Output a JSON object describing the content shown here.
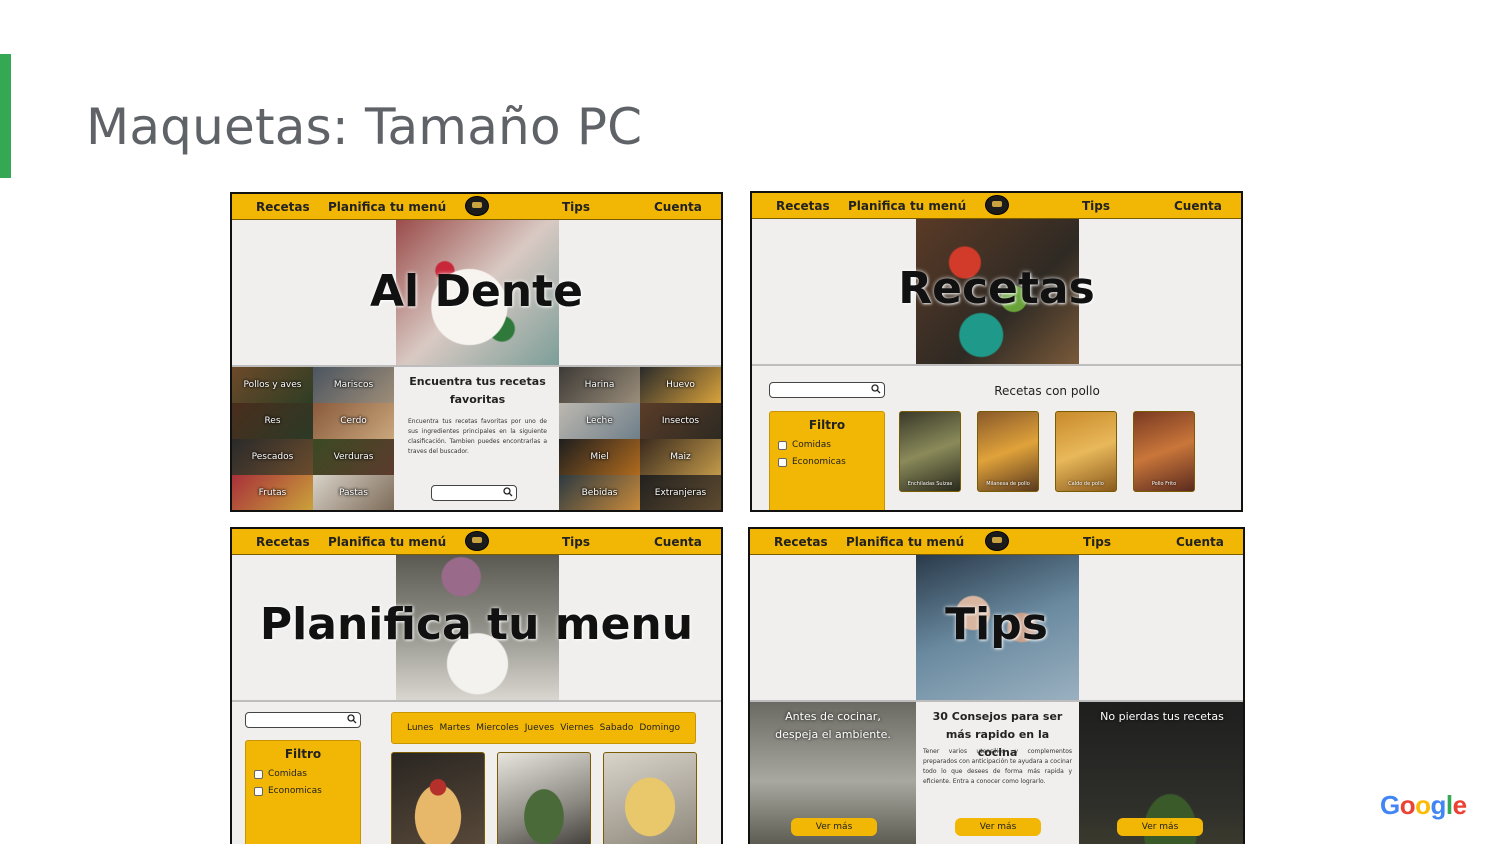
{
  "slide": {
    "title": "Maquetas: Tamaño PC",
    "accent_color": "#34a853",
    "logo_text": [
      "G",
      "o",
      "o",
      "g",
      "l",
      "e"
    ],
    "logo_colors": [
      "#4285f4",
      "#ea4335",
      "#fbbc05",
      "#4285f4",
      "#34a853",
      "#ea4335"
    ]
  },
  "nav": {
    "recetas": "Recetas",
    "planifica": "Planifica tu menú",
    "tips": "Tips",
    "cuenta": "Cuenta",
    "brand_color": "#f2b705"
  },
  "mock_home": {
    "hero_title": "Al Dente",
    "left_tiles": [
      "Pollos y aves",
      "Mariscos",
      "Res",
      "Cerdo",
      "Pescados",
      "Verduras",
      "Frutas",
      "Pastas"
    ],
    "right_tiles": [
      "Harina",
      "Huevo",
      "Leche",
      "Insectos",
      "Miel",
      "Maiz",
      "Bebidas",
      "Extranjeras"
    ],
    "info_title": "Encuentra tus recetas favoritas",
    "info_body": "Encuentra tus recetas favoritas por uno de sus ingredientes principales en la siguiente clasificación. Tambien puedes encontrarlas a traves del buscador."
  },
  "mock_recetas": {
    "hero_title": "Recetas",
    "section_title": "Recetas con pollo",
    "filter_title": "Filtro",
    "filter_options": [
      "Comidas",
      "Economicas"
    ],
    "cards": [
      "Enchiladas Suizas",
      "Milanesa de pollo",
      "Caldo de pollo",
      "Pollo Frito"
    ]
  },
  "mock_planifica": {
    "hero_title": "Planifica tu menu",
    "days": [
      "Lunes",
      "Martes",
      "Miercoles",
      "Jueves",
      "Viernes",
      "Sabado",
      "Domingo"
    ],
    "filter_title": "Filtro",
    "filter_options": [
      "Comidas",
      "Economicas"
    ]
  },
  "mock_tips": {
    "hero_title": "Tips",
    "panel_left": "Antes de cocinar, despeja el ambiente.",
    "panel_center_title": "30 Consejos para ser más rapido en la cocina",
    "panel_center_body": "Tener varios utensilios y complementos preparados con anticipación te ayudara a cocinar todo lo que desees de forma más rapida y eficiente. Entra a conocer como lograrlo.",
    "panel_right": "No pierdas tus recetas",
    "button": "Ver más"
  }
}
